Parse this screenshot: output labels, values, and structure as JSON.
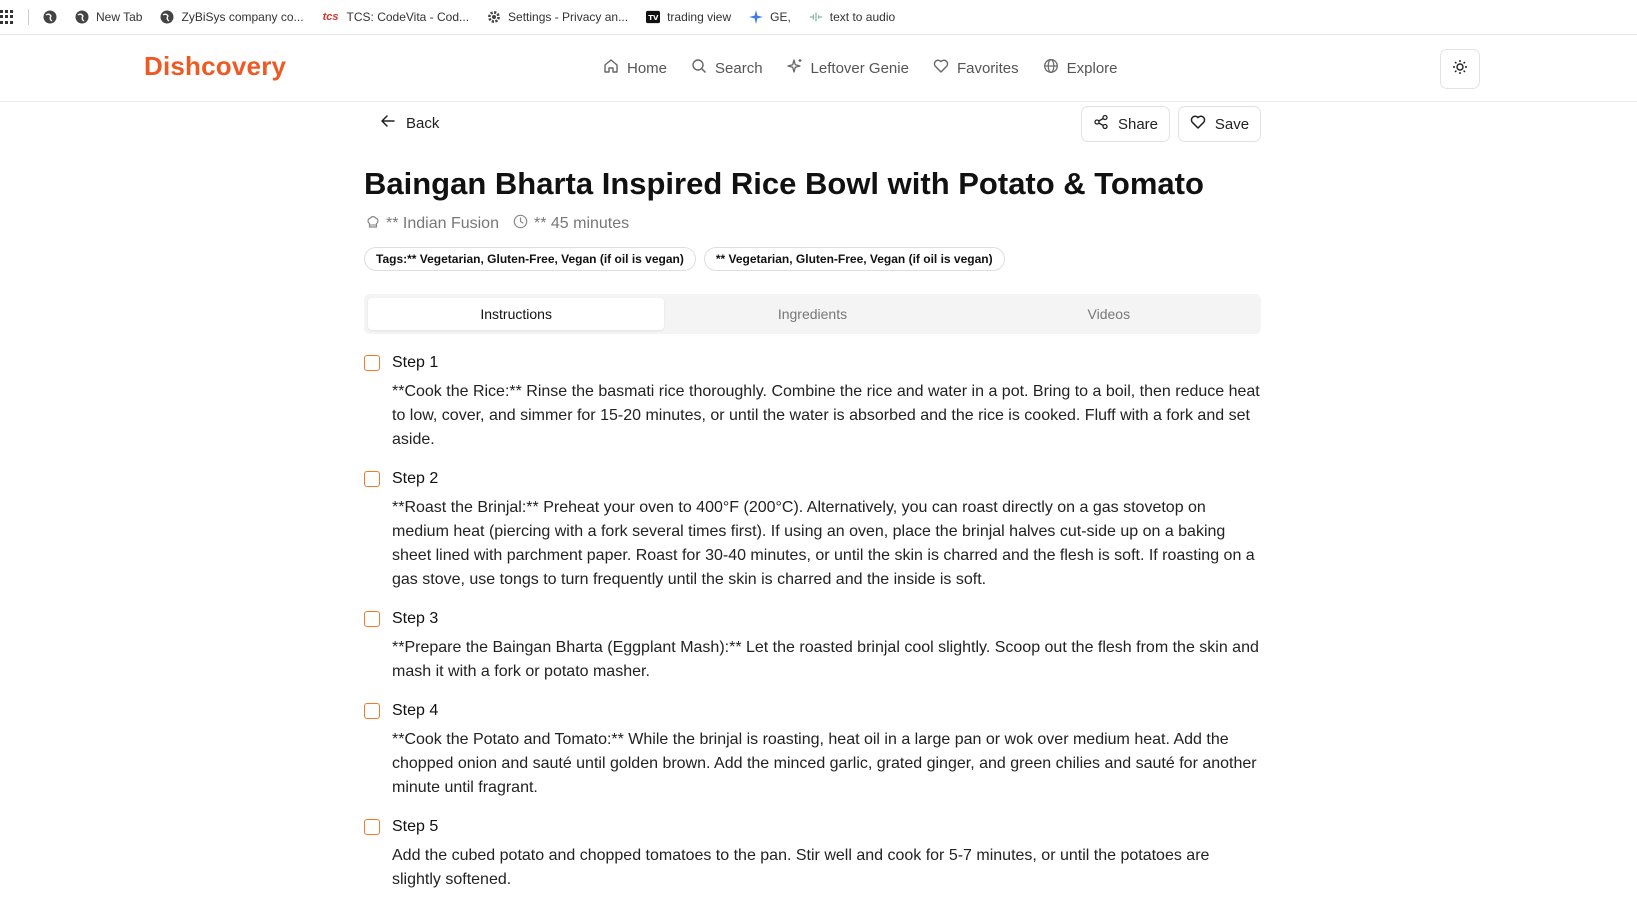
{
  "bookmarks": {
    "items": [
      {
        "label": "",
        "icon": "globe-icon"
      },
      {
        "label": "New Tab",
        "icon": "globe-icon"
      },
      {
        "label": "ZyBiSys company co...",
        "icon": "globe-icon"
      },
      {
        "label": "TCS: CodeVita - Cod...",
        "icon": "tcs-logo-icon"
      },
      {
        "label": "Settings - Privacy an...",
        "icon": "gear-icon"
      },
      {
        "label": "trading view",
        "icon": "tradingview-logo-icon"
      },
      {
        "label": "GE,",
        "icon": "sparkle-icon"
      },
      {
        "label": "text to audio",
        "icon": "audio-wave-icon"
      }
    ]
  },
  "nav": {
    "brand": "Dishcovery",
    "links": [
      {
        "label": "Home",
        "icon": "home-icon"
      },
      {
        "label": "Search",
        "icon": "search-icon"
      },
      {
        "label": "Leftover Genie",
        "icon": "sparkle-icon"
      },
      {
        "label": "Favorites",
        "icon": "heart-icon"
      },
      {
        "label": "Explore",
        "icon": "globe-icon"
      }
    ],
    "theme_icon": "sun-icon"
  },
  "actions": {
    "back": "Back",
    "share": "Share",
    "save": "Save"
  },
  "recipe": {
    "title": "Baingan Bharta Inspired Rice Bowl with Potato & Tomato",
    "cuisine": "** Indian Fusion",
    "time": "** 45 minutes",
    "tags": [
      "Tags:** Vegetarian, Gluten-Free, Vegan (if oil is vegan)",
      "** Vegetarian, Gluten-Free, Vegan (if oil is vegan)"
    ]
  },
  "tabs": {
    "instructions": "Instructions",
    "ingredients": "Ingredients",
    "videos": "Videos",
    "active": "Instructions"
  },
  "steps": [
    {
      "label": "Step 1",
      "text": "**Cook the Rice:** Rinse the basmati rice thoroughly. Combine the rice and water in a pot. Bring to a boil, then reduce heat to low, cover, and simmer for 15-20 minutes, or until the water is absorbed and the rice is cooked. Fluff with a fork and set aside."
    },
    {
      "label": "Step 2",
      "text": "**Roast the Brinjal:** Preheat your oven to 400°F (200°C). Alternatively, you can roast directly on a gas stovetop on medium heat (piercing with a fork several times first). If using an oven, place the brinjal halves cut-side up on a baking sheet lined with parchment paper. Roast for 30-40 minutes, or until the skin is charred and the flesh is soft. If roasting on a gas stove, use tongs to turn frequently until the skin is charred and the inside is soft."
    },
    {
      "label": "Step 3",
      "text": "**Prepare the Baingan Bharta (Eggplant Mash):** Let the roasted brinjal cool slightly. Scoop out the flesh from the skin and mash it with a fork or potato masher."
    },
    {
      "label": "Step 4",
      "text": "**Cook the Potato and Tomato:** While the brinjal is roasting, heat oil in a large pan or wok over medium heat. Add the chopped onion and sauté until golden brown. Add the minced garlic, grated ginger, and green chilies and sauté for another minute until fragrant."
    },
    {
      "label": "Step 5",
      "text": "Add the cubed potato and chopped tomatoes to the pan. Stir well and cook for 5-7 minutes, or until the potatoes are slightly softened."
    }
  ],
  "colors": {
    "brand": "#ee5a24",
    "checkbox": "#ee7a2a"
  }
}
